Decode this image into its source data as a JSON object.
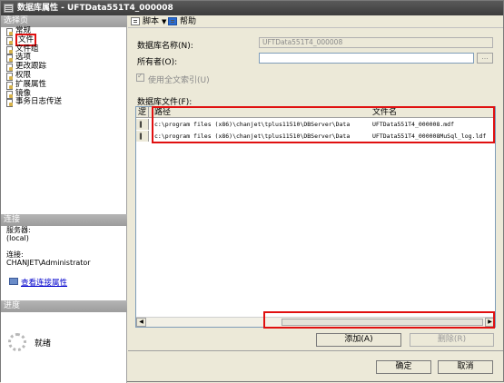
{
  "window": {
    "title": "数据库属性 - UFTData551T4_000008"
  },
  "left": {
    "select_page_header": "选择页",
    "pages": [
      {
        "label": "常规",
        "selected": false
      },
      {
        "label": "文件",
        "selected": true
      },
      {
        "label": "文件组",
        "selected": false
      },
      {
        "label": "选项",
        "selected": false
      },
      {
        "label": "更改跟踪",
        "selected": false
      },
      {
        "label": "权限",
        "selected": false
      },
      {
        "label": "扩展属性",
        "selected": false
      },
      {
        "label": "镜像",
        "selected": false
      },
      {
        "label": "事务日志传送",
        "selected": false
      }
    ],
    "connection_header": "连接",
    "server_label": "服务器:",
    "server_value": "(local)",
    "conn_label": "连接:",
    "conn_value": "CHANJET\\Administrator",
    "view_conn_link": "查看连接属性",
    "progress_header": "进度",
    "status": "就绪"
  },
  "toolbar": {
    "script_label": "脚本",
    "help_label": "帮助"
  },
  "form": {
    "db_name_label": "数据库名称(N):",
    "db_name_value": "UFTData551T4_000008",
    "owner_label": "所有者(O):",
    "owner_value": "",
    "browse_label": "...",
    "fulltext_label": "使用全文索引(U)",
    "db_files_label": "数据库文件(F):"
  },
  "grid": {
    "columns": [
      "逻",
      "路径",
      "文件名"
    ],
    "rows": [
      {
        "marker": "‖",
        "path": "c:\\program files (x86)\\chanjet\\tplus11510\\DBServer\\Data",
        "file": "UFTData551T4_000008.mdf"
      },
      {
        "marker": "‖",
        "path": "c:\\program files (x86)\\chanjet\\tplus11510\\DBServer\\Data",
        "file": "UFTData551T4_000008MuSql_log.ldf"
      }
    ]
  },
  "buttons": {
    "add": "添加(A)",
    "delete": "删除(R)",
    "ok": "确定",
    "cancel": "取消"
  }
}
